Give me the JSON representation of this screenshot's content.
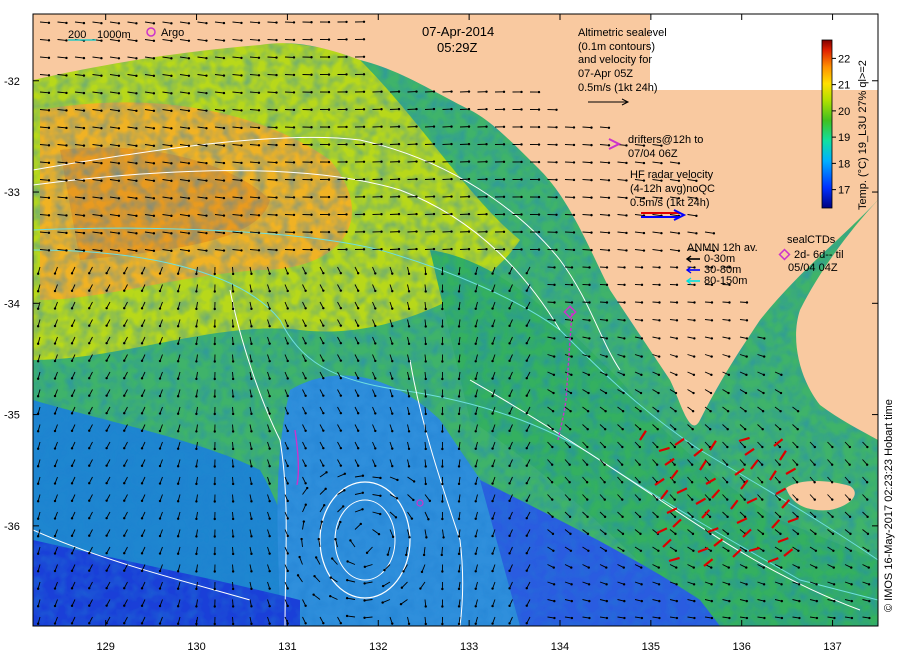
{
  "header": {
    "date": "07-Apr-2014",
    "time": "05:29Z"
  },
  "legend_bathy": {
    "label_200": "200",
    "label_1000": "1000m",
    "argo_label": "Argo"
  },
  "altimetry": {
    "line1": "Altimetric sealevel",
    "line2": "(0.1m contours)",
    "line3": "and velocity for",
    "line4": "07-Apr 05Z",
    "line5": "0.5m/s (1kt 24h)"
  },
  "drifters": {
    "line1": "drifters@12h to",
    "line2": "07/04 06Z"
  },
  "hf_radar": {
    "line1": "HF radar velocity",
    "line2": "(4-12h avg)noQC",
    "line3": "0.5m/s (1kt 24h)"
  },
  "anmn": {
    "title": "ANMN 12h av.",
    "depths": [
      "0-30m",
      "30-80m",
      "80-150m"
    ],
    "colors": [
      "#000000",
      "#0000ff",
      "#00e0e0"
    ]
  },
  "seal": {
    "title": "sealCTDs",
    "line1": "2d- 6d-- til",
    "line2": "05/04 04Z"
  },
  "colorbar": {
    "title": "Temp. (°C) 19_L3U 27% ql>=2",
    "ticks": [
      17,
      18,
      19,
      20,
      21,
      22
    ],
    "range": [
      16.3,
      22.7
    ]
  },
  "axes": {
    "x_ticks": [
      "129",
      "130",
      "131",
      "132",
      "133",
      "134",
      "135",
      "136",
      "137"
    ],
    "y_ticks": [
      "-32",
      "-33",
      "-34",
      "-35",
      "-36"
    ],
    "lon_range": [
      128.2,
      137.5
    ],
    "lat_range": [
      -31.4,
      -36.9
    ]
  },
  "credit": "© IMOS 16-May-2017 02:23:23 Hobart time",
  "colors": {
    "land": "#f9c9a0",
    "contour_200": "#6fe0e0",
    "contour_sealevel": "#ffffff",
    "arrow": "#000000",
    "hf_radar": "#dd0000",
    "drifter": "#cc33cc"
  }
}
